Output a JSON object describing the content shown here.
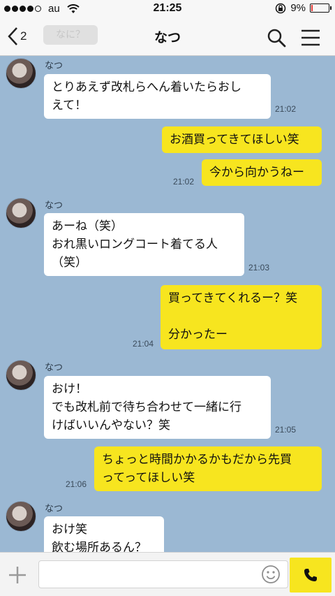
{
  "status_bar": {
    "carrier": "au",
    "time": "21:25",
    "battery_text": "9%",
    "battery_level": 0.09
  },
  "nav": {
    "back_count": "2",
    "title": "なつ",
    "ghost_preview": "なに？"
  },
  "messages": [
    {
      "side": "in",
      "sender": "なつ",
      "text": "とりあえず改札らへん着いたらおし\nえて！",
      "time": "21:02"
    },
    {
      "side": "out",
      "text": "お酒買ってきてほしい笑",
      "time": ""
    },
    {
      "side": "out",
      "text": "今から向かうねー",
      "time": "21:02"
    },
    {
      "side": "in",
      "sender": "なつ",
      "text": "あーね（笑）\nおれ黒いロングコート着てる人\n（笑）",
      "time": "21:03"
    },
    {
      "side": "out",
      "text": "買ってきてくれるー？笑\n\n分かったー",
      "time": "21:04"
    },
    {
      "side": "in",
      "sender": "なつ",
      "text": "おけ！\nでも改札前で待ち合わせて一緒に行\nけばいいんやない？笑",
      "time": "21:05"
    },
    {
      "side": "out",
      "text": "ちょっと時間かかるかもだから先買\nってってほしい笑",
      "time": "21:06"
    },
    {
      "side": "in",
      "sender": "なつ",
      "text": "おけ笑\n飲む場所あるん？",
      "time": ""
    }
  ],
  "input": {
    "placeholder": "",
    "value": ""
  },
  "colors": {
    "background": "#9bb8d3",
    "incoming_bubble": "#ffffff",
    "outgoing_bubble": "#f7e51f",
    "bars": "#f7f7f7"
  },
  "icons": {
    "back": "chevron-left-icon",
    "search": "search-icon",
    "menu": "hamburger-menu-icon",
    "plus": "plus-icon",
    "emoji": "smiley-icon",
    "call": "phone-icon",
    "wifi": "wifi-icon",
    "lock": "rotation-lock-icon",
    "battery": "battery-icon"
  }
}
